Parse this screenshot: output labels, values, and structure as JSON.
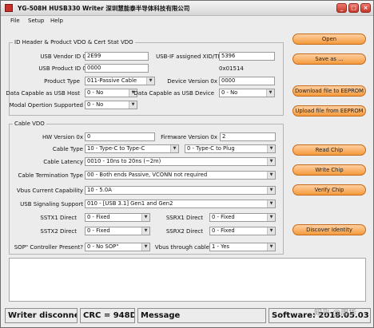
{
  "window": {
    "title": "YG-508H HUSB330 Writer  深圳慧能泰半导体科技有限公司",
    "controls": [
      "_",
      "□",
      "×"
    ]
  },
  "menu": [
    "File",
    "Setup",
    "Help"
  ],
  "id_header": {
    "title": "ID Header & Product VDO & Cert Stat VDO",
    "usb_vendor_id_label": "USB Vendor ID 0x",
    "usb_vendor_id": "2E99",
    "usb_if_label": "USB-IF assigned XID/TID",
    "usb_if_value": "5396",
    "usb_product_id_label": "USB Product ID 0x",
    "usb_product_id": "0000",
    "usb_if_hex": "0x01514",
    "product_type_label": "Product Type",
    "product_type": "011-Passive Cable",
    "device_version_label": "Device Version 0x",
    "device_version": "0000",
    "data_host_label": "Data Capable as USB Host",
    "data_host": "0 - No",
    "data_device_label": "Data Capable as USB Device",
    "data_device": "0 - No",
    "modal_label": "Modal Opertion Supported",
    "modal": "0 - No"
  },
  "cable_vdo": {
    "title": "Cable VDO",
    "hw_version_label": "HW Version  0x",
    "hw_version": "0",
    "fw_version_label": "Firmware Version  0x",
    "fw_version": "2",
    "cable_type_label": "Cable Type",
    "cable_type_a": "10 - Type-C to Type-C",
    "cable_type_b": "0 - Type-C to Plug",
    "latency_label": "Cable Latency",
    "latency": "0010 - 10ns to 20ns (~2m)",
    "termination_label": "Cable Termination Type",
    "termination": "00 - Both ends Passive, VCONN not required",
    "vbus_current_label": "Vbus Current Capability",
    "vbus_current": "10 - 5.0A",
    "signaling_label": "USB Signaling Support",
    "signaling": "010 - [USB 3.1] Gen1 and Gen2",
    "sstx1_label": "SSTX1 Direct",
    "sstx1": "0 - Fixed",
    "ssrx1_label": "SSRX1 Direct",
    "ssrx1": "0 - Fixed",
    "sstx2_label": "SSTX2 Direct",
    "sstx2": "0 - Fixed",
    "ssrx2_label": "SSRX2 Direct",
    "ssrx2": "0 - Fixed",
    "sop_label": "SOP\" Controller Present?",
    "sop": "0 - No SOP\"",
    "vbus_through_label": "Vbus through cable",
    "vbus_through": "1 - Yes"
  },
  "buttons": {
    "open": "Open",
    "save_as": "Save as ...",
    "download": "Download file to EEPROM",
    "upload": "Upload file from EEPROM",
    "read_chip": "Read Chip",
    "write_chip": "Write Chip",
    "verify_chip": "Verify Chip",
    "discover_identity": "Discover Identity"
  },
  "status": {
    "writer": "Writer disconne...",
    "crc": "CRC = 948D",
    "message": "Message",
    "software": "Software: 2018.05.03"
  },
  "watermark": "知乎 @周华",
  "colors": {
    "button_top": "#ffd0a2",
    "button_bottom": "#f49a3c",
    "close": "#c7362a"
  }
}
